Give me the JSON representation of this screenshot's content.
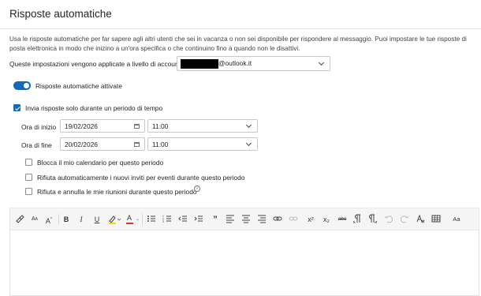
{
  "title": "Risposte automatiche",
  "description": "Usa le risposte automatiche per far sapere agli altri utenti che sei in vacanza o non sei disponibile per rispondere al messaggio. Puoi impostare le tue risposte di posta elettronica in modo che inizino a un'ora specifica o che continuino fino a quando non le disattivi.",
  "account": {
    "label": "Queste impostazioni vengono applicate a livello di account:",
    "value": "@outlook.it"
  },
  "toggle": {
    "label": "Risposte automatiche attivate",
    "on": true
  },
  "period": {
    "label": "Invia risposte solo durante un periodo di tempo",
    "checked": true
  },
  "start": {
    "label": "Ora di inizio",
    "date": "19/02/2026",
    "time": "11:00"
  },
  "end": {
    "label": "Ora di fine",
    "date": "20/02/2026",
    "time": "11:00"
  },
  "options": [
    {
      "label": "Blocca il mio calendario per questo periodo",
      "checked": false
    },
    {
      "label": "Rifiuta automaticamente i nuovi inviti per eventi durante questo periodo",
      "checked": false
    },
    {
      "label": "Rifiuta e annulla le mie riunioni durante questo periodo",
      "checked": false
    }
  ],
  "toolbar": {
    "bold": "B",
    "italic": "I",
    "underline": "U",
    "font_color": "A",
    "font_size": "A",
    "grow": "A",
    "superscript": "x²",
    "subscript": "x₂",
    "strikethrough": "abc",
    "styles": "Aa",
    "quote": "”"
  },
  "colors": {
    "accent": "#0f6cbd",
    "highlight": "#f5d90a",
    "font_color_bar": "#d13438"
  }
}
